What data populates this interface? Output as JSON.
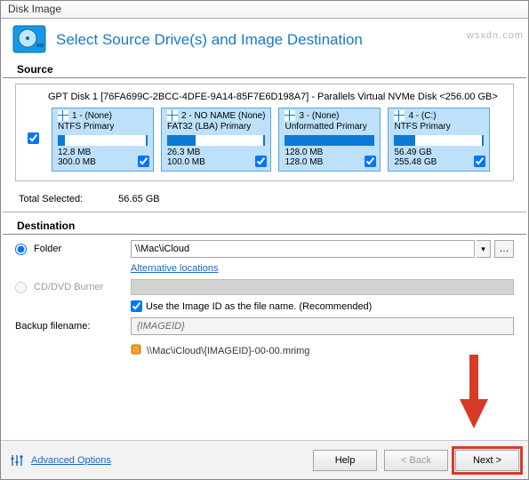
{
  "window": {
    "title": "Disk Image"
  },
  "header": {
    "title": "Select Source Drive(s) and Image Destination"
  },
  "source": {
    "label": "Source",
    "disk_title": "GPT Disk 1 [76FA699C-2BCC-4DFE-9A14-85F7E6D198A7] - Parallels Virtual NVMe Disk  <256.00 GB>",
    "disk_checked": true,
    "partitions": [
      {
        "id": "1 - (None)",
        "type": "NTFS Primary",
        "used": "12.8 MB",
        "total": "300.0 MB",
        "fill_pct": 6,
        "checked": true
      },
      {
        "id": "2 - NO NAME (None)",
        "type": "FAT32 (LBA) Primary",
        "used": "26.3 MB",
        "total": "100.0 MB",
        "fill_pct": 28,
        "checked": true
      },
      {
        "id": "3 - (None)",
        "type": "Unformatted Primary",
        "used": "128.0 MB",
        "total": "128.0 MB",
        "fill_pct": 100,
        "checked": true
      },
      {
        "id": "4 - (C:)",
        "type": "NTFS Primary",
        "used": "56.49 GB",
        "total": "255.48 GB",
        "fill_pct": 22,
        "checked": true
      }
    ]
  },
  "totals": {
    "label": "Total Selected:",
    "value": "56.65 GB"
  },
  "destination": {
    "label": "Destination",
    "folder": {
      "label": "Folder",
      "value": "\\\\Mac\\iCloud",
      "selected": true
    },
    "alt_link": "Alternative locations",
    "burner": {
      "label": "CD/DVD Burner",
      "enabled": false
    },
    "use_image_id": {
      "checked": true,
      "text": "Use the Image ID as the file name.   (Recommended)"
    },
    "backup_filename": {
      "label": "Backup filename:",
      "value": "{IMAGEID}"
    },
    "output_path": "\\\\Mac\\iCloud\\{IMAGEID}-00-00.mrimg"
  },
  "footer": {
    "advanced": "Advanced Options",
    "help": "Help",
    "back": "< Back",
    "next": "Next >"
  },
  "watermark": "wsxdn.com"
}
